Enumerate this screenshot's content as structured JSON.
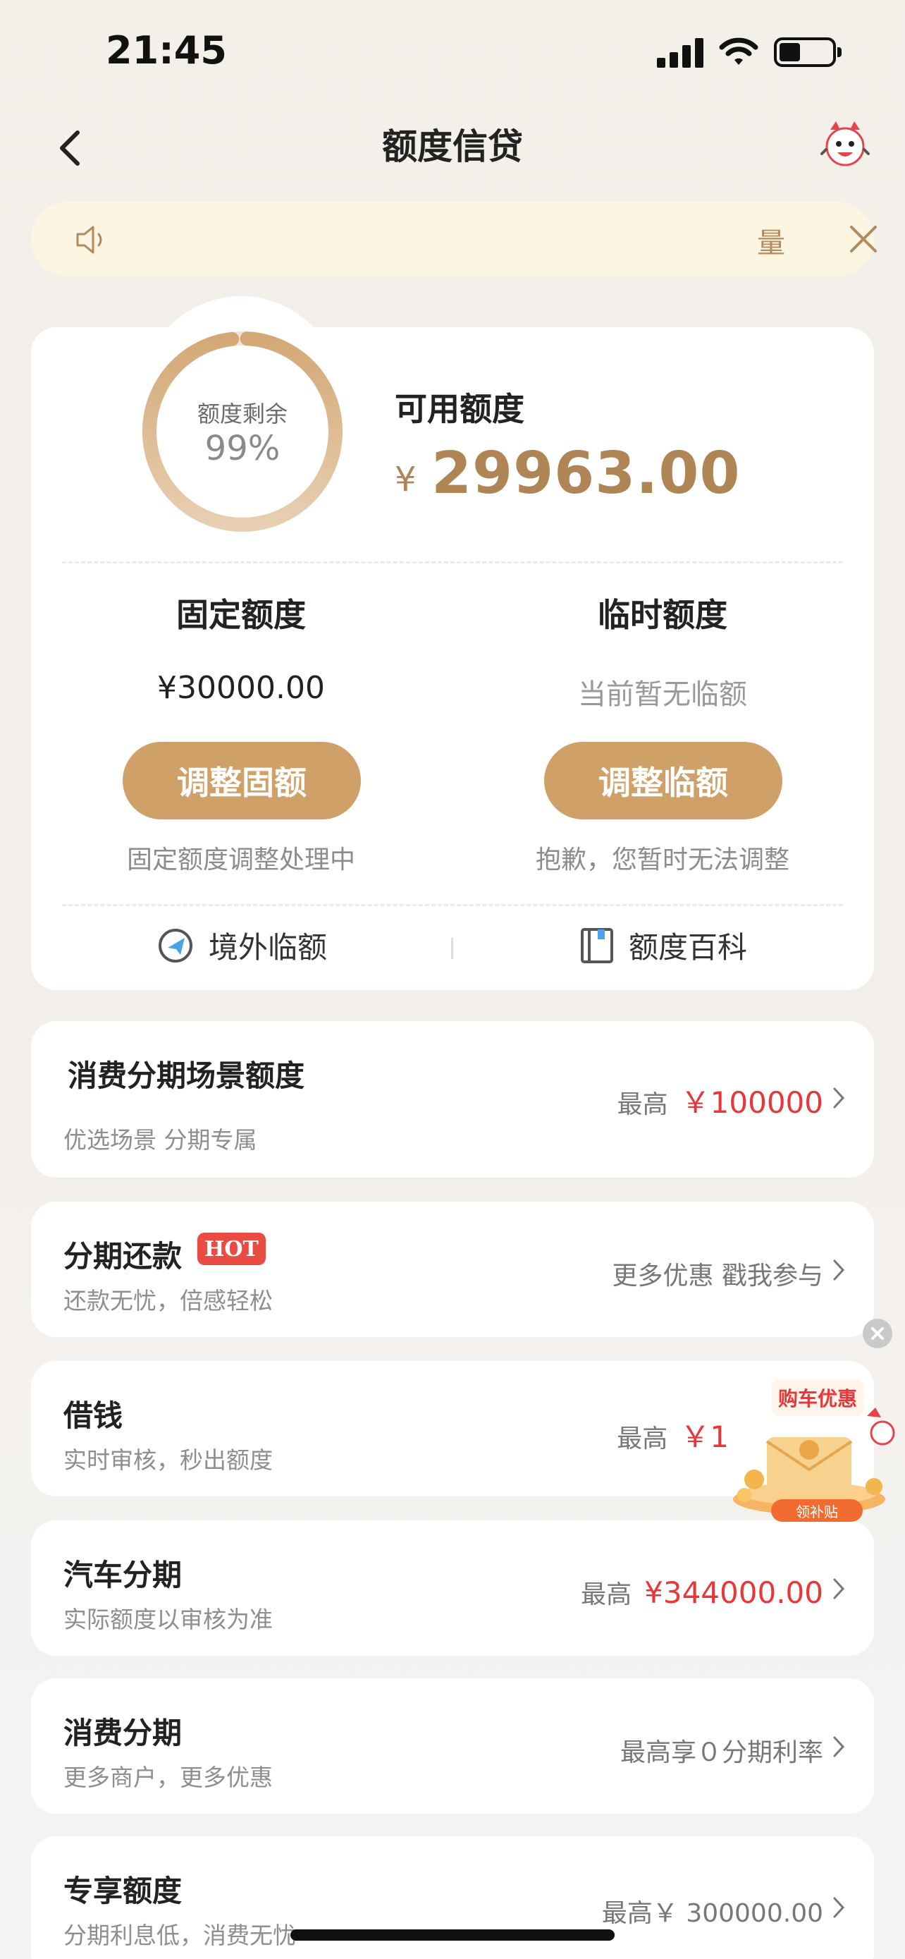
{
  "status_bar": {
    "time": "21:45"
  },
  "nav": {
    "title": "额度信贷"
  },
  "notice": {
    "text": "量"
  },
  "credit": {
    "ring_label": "额度剩余",
    "ring_percent_text": "99%",
    "remaining_fraction": 0.99,
    "available_label": "可用额度",
    "currency": "¥",
    "available_amount": "29963.00",
    "fixed": {
      "title": "固定额度",
      "value": "¥30000.00",
      "button": "调整固额",
      "note": "固定额度调整处理中"
    },
    "temporary": {
      "title": "临时额度",
      "value": "当前暂无临额",
      "button": "调整临额",
      "note": "抱歉，您暂时无法调整"
    },
    "links": [
      {
        "label": "境外临额",
        "icon": "plane-globe-icon"
      },
      {
        "label": "额度百科",
        "icon": "book-icon"
      }
    ]
  },
  "list": [
    {
      "title": "消费分期场景额度",
      "subtitle": "优选场景 分期专属",
      "right_prefix": "最高",
      "right_value": "￥100000"
    },
    {
      "title": "分期还款",
      "badge": "HOT",
      "subtitle": "还款无忧，倍感轻松",
      "right_text": "更多优惠 戳我参与"
    },
    {
      "title": "借钱",
      "subtitle": "实时审核，秒出额度",
      "right_prefix": "最高",
      "right_value": "￥1"
    },
    {
      "title": "汽车分期",
      "subtitle": "实际额度以审核为准",
      "right_prefix": "最高",
      "right_value": "¥344000.00"
    },
    {
      "title": "消费分期",
      "subtitle": "更多商户，更多优惠",
      "right_text": "最高享０分期利率"
    },
    {
      "title": "专享额度",
      "subtitle": "分期利息低，消费无忧",
      "right_text": "最高￥ 300000.00"
    }
  ],
  "float_ad": {
    "banner": "购车优惠",
    "button": "领补贴"
  },
  "colors": {
    "accent": "#cfa068",
    "gold_text": "#b08556",
    "red": "#e8373a",
    "notice_bg": "#fcf5e1"
  }
}
